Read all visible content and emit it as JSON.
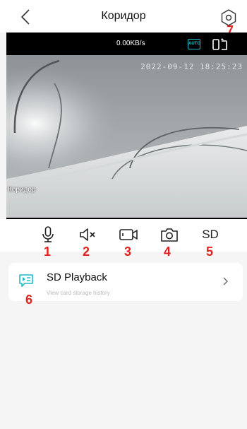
{
  "header": {
    "title": "Коридор"
  },
  "video": {
    "speed": "0.00KB/s",
    "auto_label": "AUTO",
    "timestamp": "2022-09-12 18:25:23",
    "camera_name": "Коридор"
  },
  "controls": {
    "sd_label": "SD"
  },
  "annotations": [
    "1",
    "2",
    "3",
    "4",
    "5",
    "6",
    "7"
  ],
  "playback": {
    "title": "SD Playback",
    "subtitle": "View card storage history"
  },
  "colors": {
    "annotation": "#e3211d",
    "accent": "#1fbac7",
    "background": "#f5f5f6"
  }
}
